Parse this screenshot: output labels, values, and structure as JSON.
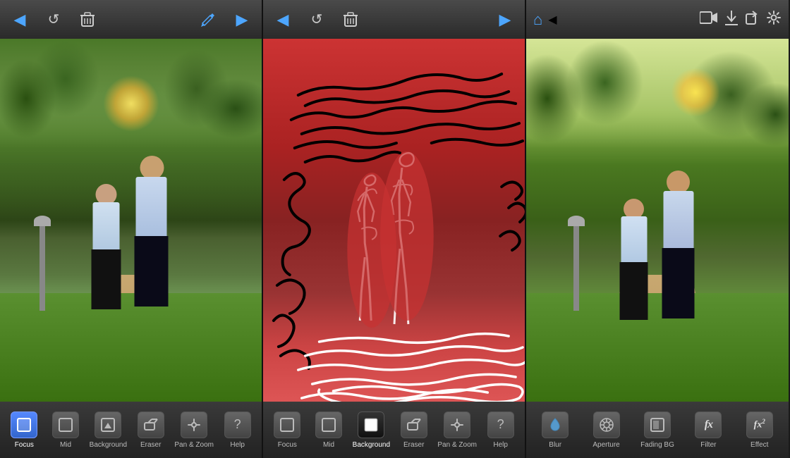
{
  "panels": [
    {
      "id": "left",
      "toolbar_top": {
        "buttons": [
          {
            "id": "back",
            "icon": "◀",
            "label": "back",
            "color": "blue"
          },
          {
            "id": "undo",
            "icon": "↺",
            "label": "undo"
          },
          {
            "id": "delete",
            "icon": "🗑",
            "label": "delete"
          },
          {
            "id": "pen",
            "icon": "✏",
            "label": "pen",
            "color": "blue"
          },
          {
            "id": "forward",
            "icon": "▶",
            "label": "forward",
            "color": "blue"
          }
        ]
      },
      "toolbar_bottom": {
        "tools": [
          {
            "id": "focus",
            "label": "Focus",
            "active": true,
            "icon": "□"
          },
          {
            "id": "mid",
            "label": "Mid",
            "icon": "□"
          },
          {
            "id": "background",
            "label": "Background",
            "icon": "□"
          },
          {
            "id": "eraser",
            "label": "Eraser",
            "icon": "◻"
          },
          {
            "id": "pan-zoom",
            "label": "Pan & Zoom",
            "icon": "✋"
          },
          {
            "id": "help",
            "label": "Help",
            "icon": "?"
          }
        ]
      }
    },
    {
      "id": "center",
      "toolbar_top": {
        "buttons": [
          {
            "id": "back",
            "icon": "◀",
            "label": "back",
            "color": "blue"
          },
          {
            "id": "undo",
            "icon": "↺",
            "label": "undo"
          },
          {
            "id": "delete",
            "icon": "🗑",
            "label": "delete"
          },
          {
            "id": "forward",
            "icon": "▶",
            "label": "forward",
            "color": "blue"
          }
        ]
      },
      "toolbar_bottom": {
        "tools": [
          {
            "id": "focus",
            "label": "Focus",
            "icon": "□"
          },
          {
            "id": "mid",
            "label": "Mid",
            "icon": "□"
          },
          {
            "id": "background",
            "label": "Background",
            "active": true,
            "icon": "■"
          },
          {
            "id": "eraser",
            "label": "Eraser",
            "icon": "◻"
          },
          {
            "id": "pan-zoom",
            "label": "Pan & Zoom",
            "icon": "✋"
          },
          {
            "id": "help",
            "label": "Help",
            "icon": "?"
          }
        ]
      }
    },
    {
      "id": "right",
      "toolbar_top": {
        "buttons": [
          {
            "id": "home",
            "icon": "⌂",
            "label": "home",
            "color": "blue"
          },
          {
            "id": "back",
            "icon": "◀",
            "label": "back",
            "color": "blue"
          },
          {
            "id": "video",
            "icon": "🎥",
            "label": "video"
          },
          {
            "id": "download",
            "icon": "⬇",
            "label": "download"
          },
          {
            "id": "share",
            "icon": "↗",
            "label": "share"
          },
          {
            "id": "settings",
            "icon": "⚙",
            "label": "settings"
          }
        ]
      },
      "toolbar_bottom": {
        "tools": [
          {
            "id": "blur",
            "label": "Blur",
            "icon": "💧"
          },
          {
            "id": "aperture",
            "label": "Aperture",
            "icon": "◎"
          },
          {
            "id": "fading-bg",
            "label": "Fading BG",
            "icon": "□"
          },
          {
            "id": "filter",
            "label": "Filter",
            "icon": "fx"
          },
          {
            "id": "effect",
            "label": "Effect",
            "icon": "fx²"
          }
        ]
      }
    }
  ],
  "labels": {
    "background_left": "Background",
    "background_center": "Background",
    "effect_right": "Effect"
  }
}
